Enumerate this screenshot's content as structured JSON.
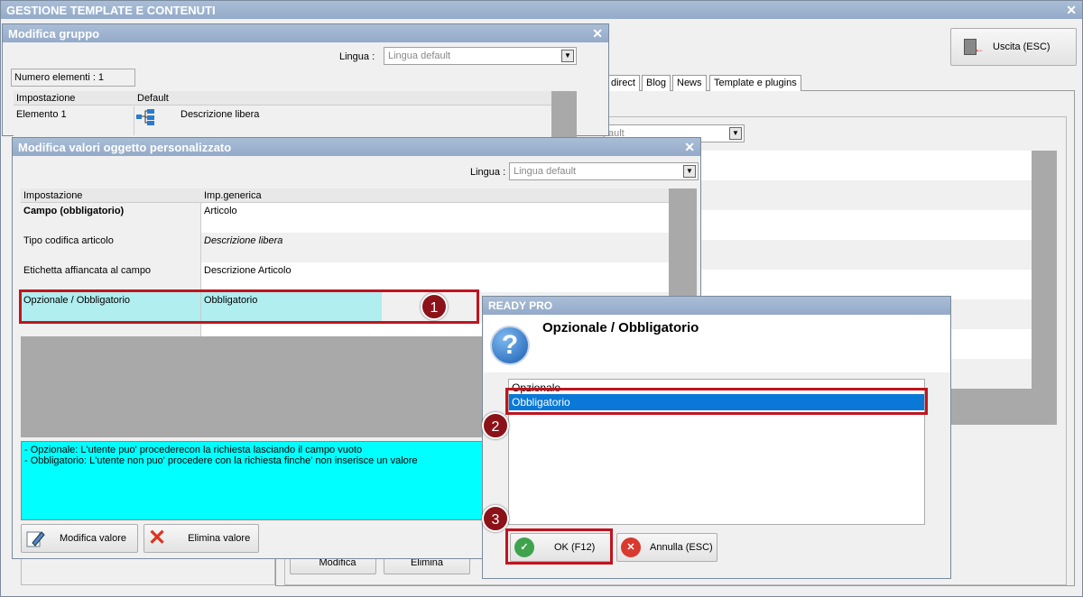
{
  "main": {
    "title": "GESTIONE TEMPLATE E CONTENUTI",
    "exit_label": "Uscita (ESC)",
    "tabs": [
      "direct",
      "Blog",
      "News",
      "Template e plugins"
    ],
    "bg_combo_value": "ault",
    "modify_label": "Modifica",
    "delete_label": "Elimina"
  },
  "group_dialog": {
    "title": "Modifica gruppo",
    "lingua_label": "Lingua :",
    "lingua_value": "Lingua default",
    "count_label": "Numero elementi : 1",
    "headers": [
      "Impostazione",
      "Default"
    ],
    "row": {
      "name": "Elemento 1",
      "value": "Descrizione libera",
      "icon": "tree-icon"
    }
  },
  "values_dialog": {
    "title": "Modifica valori oggetto personalizzato",
    "lingua_label": "Lingua :",
    "lingua_value": "Lingua default",
    "headers": [
      "Impostazione",
      "Imp.generica"
    ],
    "rows": [
      {
        "name": "Campo (obbligatorio)",
        "value": "Articolo"
      },
      {
        "name": "Tipo codifica articolo",
        "value": "Descrizione libera"
      },
      {
        "name": "Etichetta affiancata al campo",
        "value": "Descrizione Articolo"
      },
      {
        "name": "Opzionale / Obbligatorio",
        "value": "Obbligatorio"
      }
    ],
    "help_lines": [
      "- Opzionale: L'utente puo' procederecon la richiesta lasciando il campo vuoto",
      "- Obbligatorio: L'utente non puo' procedere con la richiesta finche' non inserisce un valore"
    ],
    "edit_label": "Modifica valore",
    "delete_label": "Elimina valore"
  },
  "choice_dialog": {
    "title": "READY PRO",
    "question": "Opzionale / Obbligatorio",
    "options": [
      "Opzionale",
      "Obbligatorio"
    ],
    "selected": "Obbligatorio",
    "ok_label": "OK (F12)",
    "cancel_label": "Annulla (ESC)"
  },
  "badges": [
    "1",
    "2",
    "3"
  ],
  "colors": {
    "accent_red": "#c0141e",
    "badge": "#8b1219",
    "help_bg": "#00ffff",
    "selected_row": "#b0eef0",
    "list_selected": "#0a78d7"
  }
}
